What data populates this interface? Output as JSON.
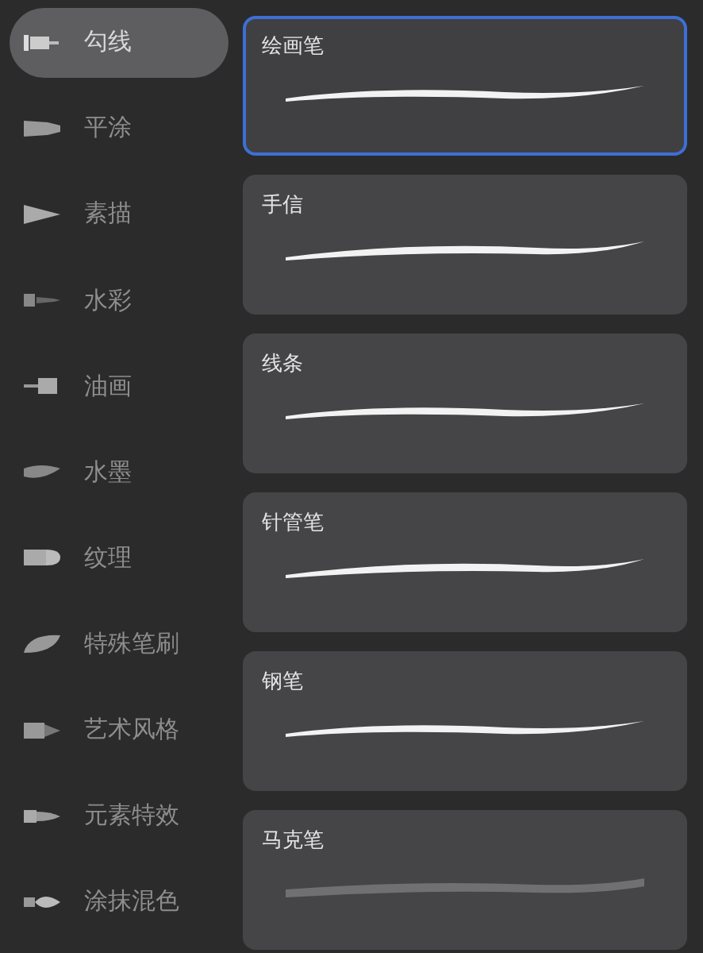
{
  "categories": [
    {
      "label": "勾线",
      "selected": true
    },
    {
      "label": "平涂",
      "selected": false
    },
    {
      "label": "素描",
      "selected": false
    },
    {
      "label": "水彩",
      "selected": false
    },
    {
      "label": "油画",
      "selected": false
    },
    {
      "label": "水墨",
      "selected": false
    },
    {
      "label": "纹理",
      "selected": false
    },
    {
      "label": "特殊笔刷",
      "selected": false
    },
    {
      "label": "艺术风格",
      "selected": false
    },
    {
      "label": "元素特效",
      "selected": false
    },
    {
      "label": "涂抹混色",
      "selected": false
    }
  ],
  "brushes": [
    {
      "name": "绘画笔",
      "selected": true,
      "kind": "solid"
    },
    {
      "name": "手信",
      "selected": false,
      "kind": "solid"
    },
    {
      "name": "线条",
      "selected": false,
      "kind": "solid"
    },
    {
      "name": "针管笔",
      "selected": false,
      "kind": "solid"
    },
    {
      "name": "钢笔",
      "selected": false,
      "kind": "solid"
    },
    {
      "name": "马克笔",
      "selected": false,
      "kind": "marker"
    }
  ]
}
